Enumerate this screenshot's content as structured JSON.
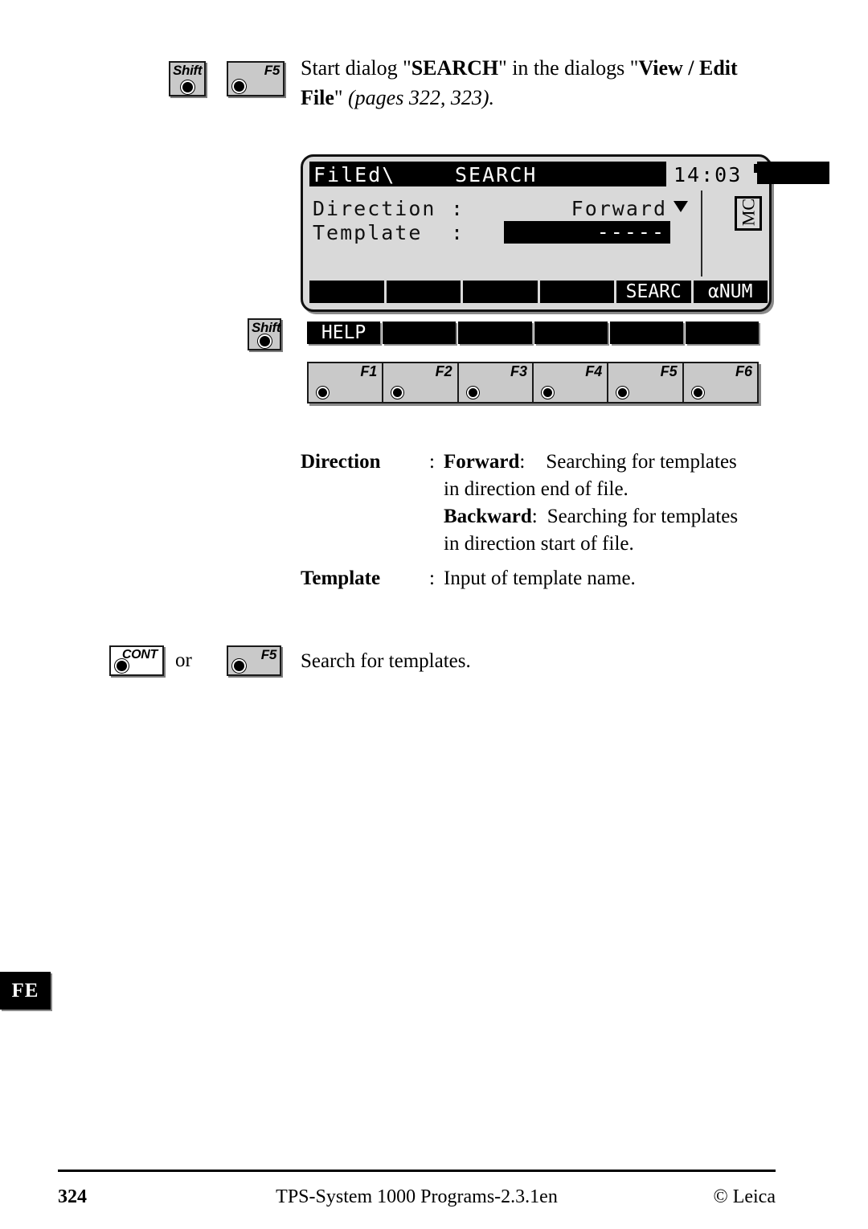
{
  "instruction": {
    "keys": [
      {
        "label": "Shift",
        "type": "shift"
      },
      {
        "label": "F5",
        "type": "fn"
      }
    ],
    "line1_a": "Start dialog \"",
    "line1_b": "SEARCH",
    "line1_c": "\" in the dialogs \"",
    "line1_d": "View / Edit",
    "line2_a": "File",
    "line2_b": "\" ",
    "line2_c": "(pages 322, 323)",
    "line2_d": "."
  },
  "lcd": {
    "path": "FilEd\\",
    "title": "SEARCH",
    "clock": "14:03",
    "battery_icon": "battery-full-icon",
    "mode_indicator": "MC",
    "fields": [
      {
        "label": "Direction",
        "colon": ":",
        "value": "Forward",
        "dropdown_icon": "chevron-down-icon",
        "highlighted": false
      },
      {
        "label": "Template",
        "colon": ":",
        "value": "-----",
        "highlighted": true
      }
    ],
    "softkeys": [
      "",
      "",
      "",
      "",
      "SEARC",
      "αNUM"
    ]
  },
  "shift_row": {
    "key": {
      "label": "Shift",
      "type": "shift"
    },
    "softkeys": [
      "HELP",
      "",
      "",
      "",
      "",
      ""
    ]
  },
  "fkeys": [
    "F1",
    "F2",
    "F3",
    "F4",
    "F5",
    "F6"
  ],
  "descriptions": [
    {
      "term": "Direction",
      "colon": ":",
      "lines": [
        {
          "bold": "Forward",
          "bold_colon": ":",
          "text": "Searching for templates"
        },
        {
          "bold": "",
          "bold_colon": "",
          "text": "in direction end of file."
        },
        {
          "bold": "Backward",
          "bold_colon": ":",
          "text": "Searching for templates"
        },
        {
          "bold": "",
          "bold_colon": "",
          "text": "in direction start of file."
        }
      ]
    },
    {
      "term": "Template",
      "colon": ":",
      "lines": [
        {
          "bold": "",
          "bold_colon": "",
          "text": "Input of template name."
        }
      ]
    }
  ],
  "action": {
    "key_cont": {
      "label": "CONT"
    },
    "conjunction": "or",
    "key_f5": {
      "label": "F5"
    },
    "text": "Search for templates."
  },
  "side_tab": "FE",
  "footer": {
    "page_number": "324",
    "center": "TPS-System 1000 Programs-2.3.1en",
    "right": "© Leica"
  }
}
